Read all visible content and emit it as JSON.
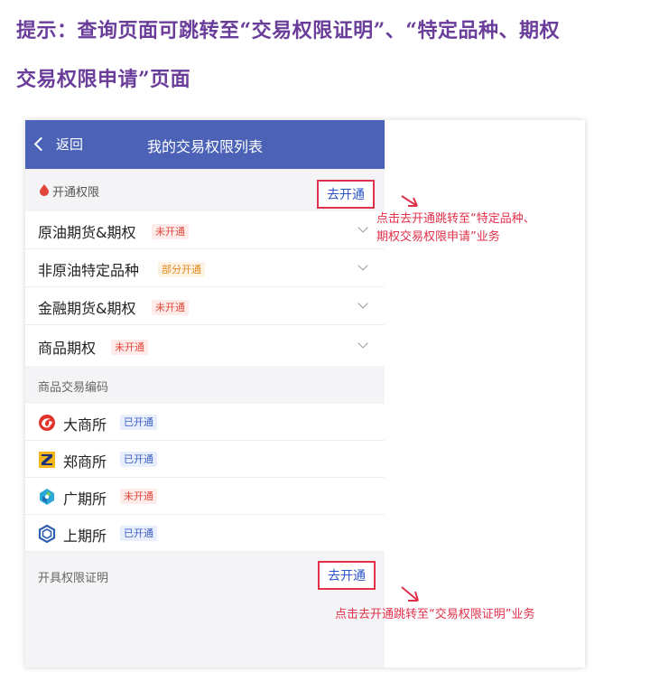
{
  "tips": {
    "line1": "提示：查询页面可跳转至“交易权限证明”、“特定品种、期权",
    "line2": "交易权限申请”页面"
  },
  "nav": {
    "back_label": "返回",
    "title": "我的交易权限列表"
  },
  "open_section": {
    "title": "开通权限",
    "button_label": "去开通"
  },
  "permissions": [
    {
      "name": "原油期货&期权",
      "status": "未开通",
      "status_color": "red"
    },
    {
      "name": "非原油特定品种",
      "status": "部分开通",
      "status_color": "orange"
    },
    {
      "name": "金融期货&期权",
      "status": "未开通",
      "status_color": "red"
    },
    {
      "name": "商品期权",
      "status": "未开通",
      "status_color": "red"
    }
  ],
  "codes_section": {
    "title": "商品交易编码"
  },
  "exchanges": [
    {
      "name": "大商所",
      "status": "已开通",
      "status_color": "blue",
      "icon": "dce-logo-icon"
    },
    {
      "name": "郑商所",
      "status": "已开通",
      "status_color": "blue",
      "icon": "czce-logo-icon"
    },
    {
      "name": "广期所",
      "status": "未开通",
      "status_color": "red",
      "icon": "gfex-logo-icon"
    },
    {
      "name": "上期所",
      "status": "已开通",
      "status_color": "blue",
      "icon": "shfe-logo-icon"
    }
  ],
  "proof_section": {
    "title": "开具权限证明",
    "button_label": "去开通"
  },
  "annotations": {
    "note1_line1": "点击去开通跳转至“特定品种、",
    "note1_line2": "期权交易权限申请”业务",
    "note2": "点击去开通跳转至“交易权限证明”业务"
  },
  "colors": {
    "tip_text": "#6a3d9a",
    "nav_bg": "#4b62b7",
    "highlight_red": "#e0304a",
    "link_blue": "#2b55c8"
  }
}
